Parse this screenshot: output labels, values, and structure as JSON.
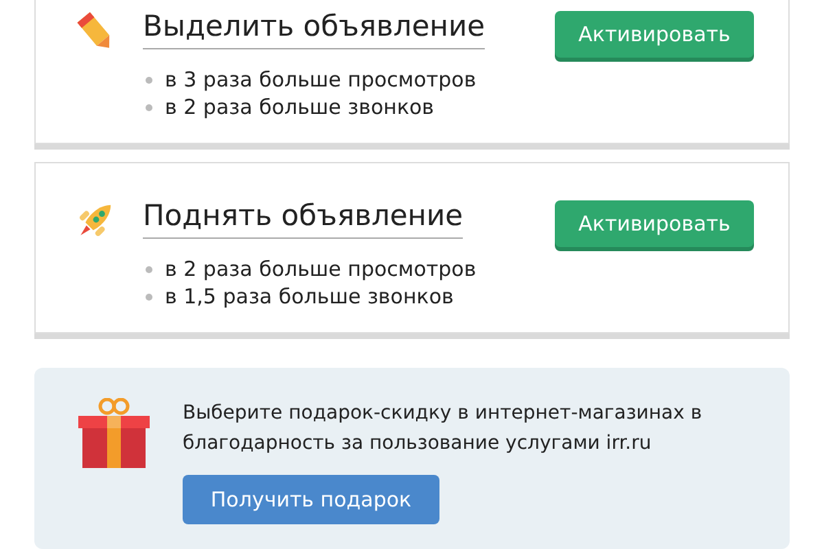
{
  "services": [
    {
      "kind": "pencil",
      "title": "Выделить объявление",
      "benefits": [
        "в 3 раза больше просмотров",
        "в 2 раза больше звонков"
      ],
      "button": "Активировать"
    },
    {
      "kind": "rocket",
      "title": "Поднять объявление",
      "benefits": [
        "в 2 раза больше просмотров",
        "в 1,5 раза больше звонков"
      ],
      "button": "Активировать"
    }
  ],
  "gift": {
    "text": "Выберите подарок-скидку в интернет-магазинах в благодарность за пользование услугами irr.ru",
    "button": "Получить подарок"
  }
}
